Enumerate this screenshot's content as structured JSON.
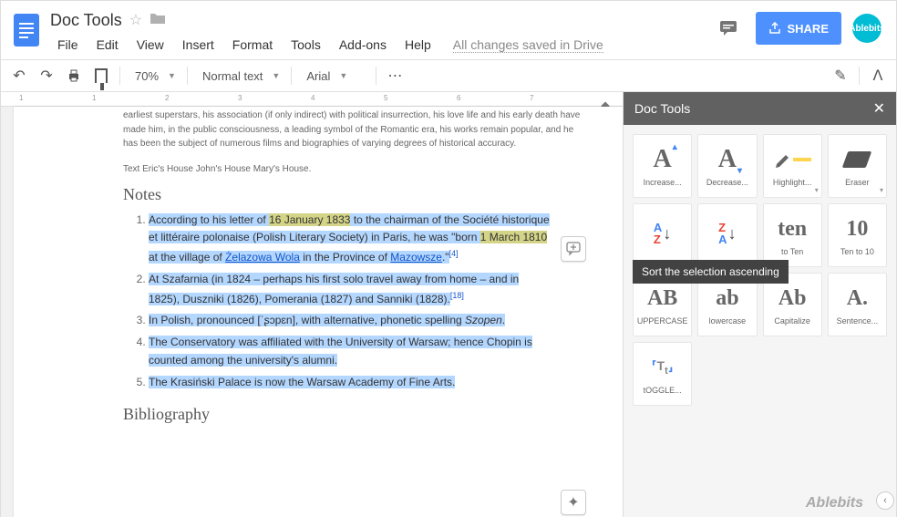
{
  "header": {
    "doc_title": "Doc Tools",
    "menus": [
      "File",
      "Edit",
      "View",
      "Insert",
      "Format",
      "Tools",
      "Add-ons",
      "Help"
    ],
    "saved_status": "All changes saved in Drive",
    "share_label": "SHARE",
    "avatar_label": "Ablebits"
  },
  "toolbar": {
    "zoom": "70%",
    "style": "Normal text",
    "font": "Arial"
  },
  "ruler_marks": [
    "1",
    "1",
    "2",
    "3",
    "4",
    "5",
    "6",
    "7"
  ],
  "doc": {
    "intro": "earliest superstars, his association (if only indirect) with political insurrection, his love life and his early death have made him, in the public consciousness, a leading symbol of the Romantic era, his works remain popular, and he has been the subject of numerous films and biographies of varying degrees of historical accuracy.",
    "text_line": "Text Eric's House John's House Mary's House.",
    "notes_heading": "Notes",
    "notes": [
      {
        "pre": "According to his letter of ",
        "h1": "16 January 1833",
        "mid": " to the chairman of the Société historique et littéraire polonaise (Polish Literary Society) in Paris, he was \"born ",
        "h2": "1 March 1810",
        "mid2": " at the village of ",
        "link": "Żelazowa Wola",
        "mid3": " in the Province of ",
        "link2": "Mazowsze",
        "post": ".\"",
        "cite": "[4]"
      },
      {
        "text": "At Szafarnia (in 1824 – perhaps his first solo travel away from home – and in 1825), Duszniki (1826), Pomerania (1827) and Sanniki (1828).",
        "cite": "[18]"
      },
      {
        "text": "In Polish, pronounced [ˈʂɔpɛn], with alternative, phonetic spelling ",
        "ital": "Szopen",
        "post": "."
      },
      {
        "text": "The Conservatory was affiliated with the University of Warsaw; hence Chopin is counted among the university's alumni."
      },
      {
        "text": "The Krasiński Palace is now the Warsaw Academy of Fine Arts."
      }
    ],
    "biblio_heading": "Bibliography"
  },
  "sidebar": {
    "title": "Doc Tools",
    "tools": [
      {
        "id": "increase",
        "label": "Increase...",
        "glyph": "A",
        "accent": "up"
      },
      {
        "id": "decrease",
        "label": "Decrease...",
        "glyph": "A",
        "accent": "down"
      },
      {
        "id": "highlight",
        "label": "Highlight...",
        "glyph": "highlight",
        "dd": true
      },
      {
        "id": "eraser",
        "label": "Eraser",
        "glyph": "eraser",
        "dd": true
      },
      {
        "id": "sort-asc",
        "label": "",
        "glyph": "sortAZ"
      },
      {
        "id": "sort-desc",
        "label": "",
        "glyph": "sortZA"
      },
      {
        "id": "ten-to-ten",
        "label": "to Ten",
        "glyph": "ten",
        "text": "ten"
      },
      {
        "id": "ten-to-10",
        "label": "Ten to 10",
        "glyph": "10",
        "text": "10"
      },
      {
        "id": "uppercase",
        "label": "UPPERCASE",
        "glyph": "text",
        "text": "AB"
      },
      {
        "id": "lowercase",
        "label": "lowercase",
        "glyph": "text",
        "text": "ab"
      },
      {
        "id": "capitalize",
        "label": "Capitalize",
        "glyph": "text",
        "text": "Ab"
      },
      {
        "id": "sentence",
        "label": "Sentence...",
        "glyph": "text",
        "text": "A."
      },
      {
        "id": "toggle",
        "label": "tOGGLE...",
        "glyph": "toggle"
      }
    ],
    "tooltip": "Sort the selection ascending",
    "brand": "Ablebits"
  }
}
